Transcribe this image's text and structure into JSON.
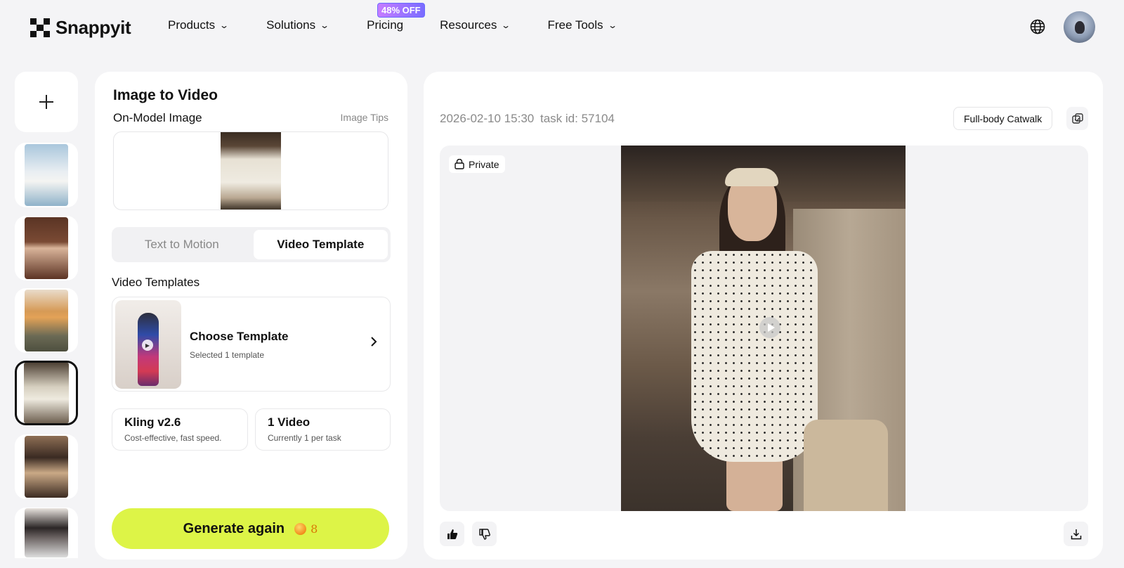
{
  "header": {
    "logo_text": "Snappyit",
    "nav": [
      {
        "label": "Products"
      },
      {
        "label": "Solutions"
      },
      {
        "label": "Pricing"
      },
      {
        "label": "Resources"
      },
      {
        "label": "Free Tools"
      }
    ],
    "pricing_badge": "48% OFF"
  },
  "left_panel": {
    "title": "Image to Video",
    "subtitle": "On-Model Image",
    "tips": "Image Tips",
    "tabs": [
      {
        "label": "Text to Motion",
        "active": false
      },
      {
        "label": "Video Template",
        "active": true
      }
    ],
    "templates_heading": "Video Templates",
    "template_card": {
      "title": "Choose Template",
      "subtitle": "Selected 1 template"
    },
    "model_option": {
      "title": "Kling v2.6",
      "subtitle": "Cost-effective, fast speed."
    },
    "count_option": {
      "title": "1 Video",
      "subtitle": "Currently 1 per task"
    },
    "generate_button": "Generate again",
    "credit_cost": "8"
  },
  "right_panel": {
    "date": "2026-02-10 15:30",
    "task_id": "task id: 57104",
    "tag": "Full-body Catwalk",
    "private_label": "Private"
  },
  "colors": {
    "accent": "#ddf447",
    "badge": "#8a6cff"
  }
}
